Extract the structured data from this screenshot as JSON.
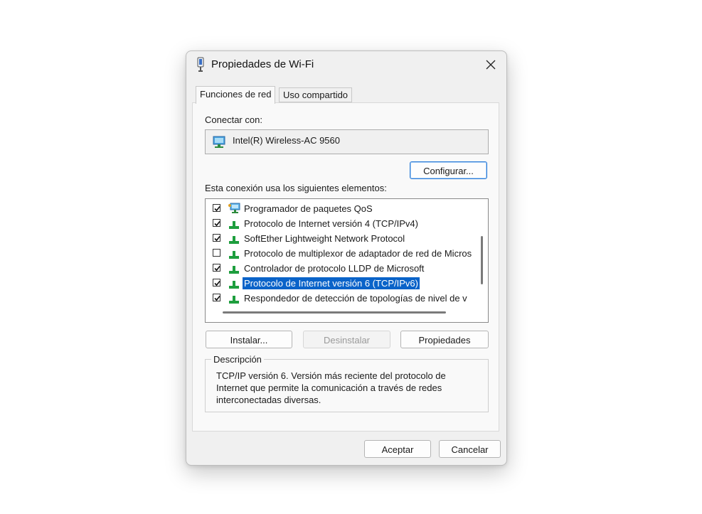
{
  "window": {
    "title": "Propiedades de Wi-Fi",
    "close_label": "✕"
  },
  "tabs": [
    {
      "label": "Funciones de red",
      "active": true
    },
    {
      "label": "Uso compartido",
      "active": false
    }
  ],
  "connect": {
    "label": "Conectar con:",
    "adapter": "Intel(R) Wireless-AC 9560",
    "configure_button": "Configurar..."
  },
  "items_label": "Esta conexión usa los siguientes elementos:",
  "items": [
    {
      "label": "Programador de paquetes QoS",
      "checked": true,
      "icon": "qos-scheduler-icon",
      "selected": false
    },
    {
      "label": "Protocolo de Internet versión 4 (TCP/IPv4)",
      "checked": true,
      "icon": "network-protocol-icon",
      "selected": false
    },
    {
      "label": "SoftEther Lightweight Network Protocol",
      "checked": true,
      "icon": "network-protocol-icon",
      "selected": false
    },
    {
      "label": "Protocolo de multiplexor de adaptador de red de Micros",
      "checked": false,
      "icon": "network-protocol-icon",
      "selected": false
    },
    {
      "label": "Controlador de protocolo LLDP de Microsoft",
      "checked": true,
      "icon": "network-protocol-icon",
      "selected": false
    },
    {
      "label": "Protocolo de Internet versión 6 (TCP/IPv6)",
      "checked": true,
      "icon": "network-protocol-icon",
      "selected": true
    },
    {
      "label": "Respondedor de detección de topologías de nivel de v",
      "checked": true,
      "icon": "network-protocol-icon",
      "selected": false
    }
  ],
  "buttons": {
    "install": "Instalar...",
    "uninstall": "Desinstalar",
    "properties": "Propiedades",
    "accept": "Aceptar",
    "cancel": "Cancelar"
  },
  "description": {
    "legend": "Descripción",
    "lines": [
      "TCP/IP versión 6. Versión más reciente del protocolo de",
      "Internet que permite la comunicación a través de redes",
      "interconectadas diversas."
    ]
  },
  "colors": {
    "selection": "#0a63c9",
    "accent_border": "#2a7bd8",
    "protocol_icon_green": "#1e9e3e"
  }
}
